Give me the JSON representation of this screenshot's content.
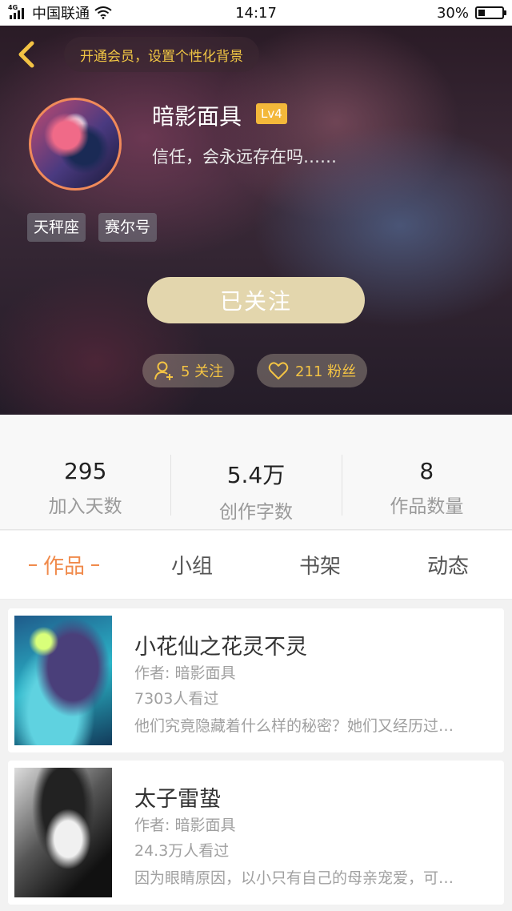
{
  "status_bar": {
    "network": "4G",
    "carrier": "中国联通",
    "time": "14:17",
    "battery": "30%",
    "battery_level": 0.3
  },
  "header": {
    "vip_prompt": "开通会员，设置个性化背景",
    "username": "暗影面具",
    "level": "Lv4",
    "signature": "信任，会永远存在吗……",
    "tags": [
      "天秤座",
      "赛尔号"
    ],
    "follow_label": "已关注",
    "following": "5 关注",
    "fans": "211 粉丝",
    "colors": {
      "accent": "#f3c344",
      "follow_button": "#e3d6ad",
      "level_badge": "#f3b83a"
    }
  },
  "stats": [
    {
      "value": "295",
      "label": "加入天数"
    },
    {
      "value": "5.4万",
      "label": "创作字数"
    },
    {
      "value": "8",
      "label": "作品数量"
    }
  ],
  "tabs": [
    {
      "label": "作品",
      "active": true
    },
    {
      "label": "小组",
      "active": false
    },
    {
      "label": "书架",
      "active": false
    },
    {
      "label": "动态",
      "active": false
    }
  ],
  "tab_active_color": "#f08a4b",
  "books": [
    {
      "title": "小花仙之花灵不灵",
      "author": "作者: 暗影面具",
      "views": "7303人看过",
      "summary": "他们究竟隐藏着什么样的秘密？她们又经历过…"
    },
    {
      "title": "太子雷蛰",
      "author": "作者: 暗影面具",
      "views": "24.3万人看过",
      "summary": "因为眼睛原因，以小只有自己的母亲宠爱，可…"
    }
  ]
}
